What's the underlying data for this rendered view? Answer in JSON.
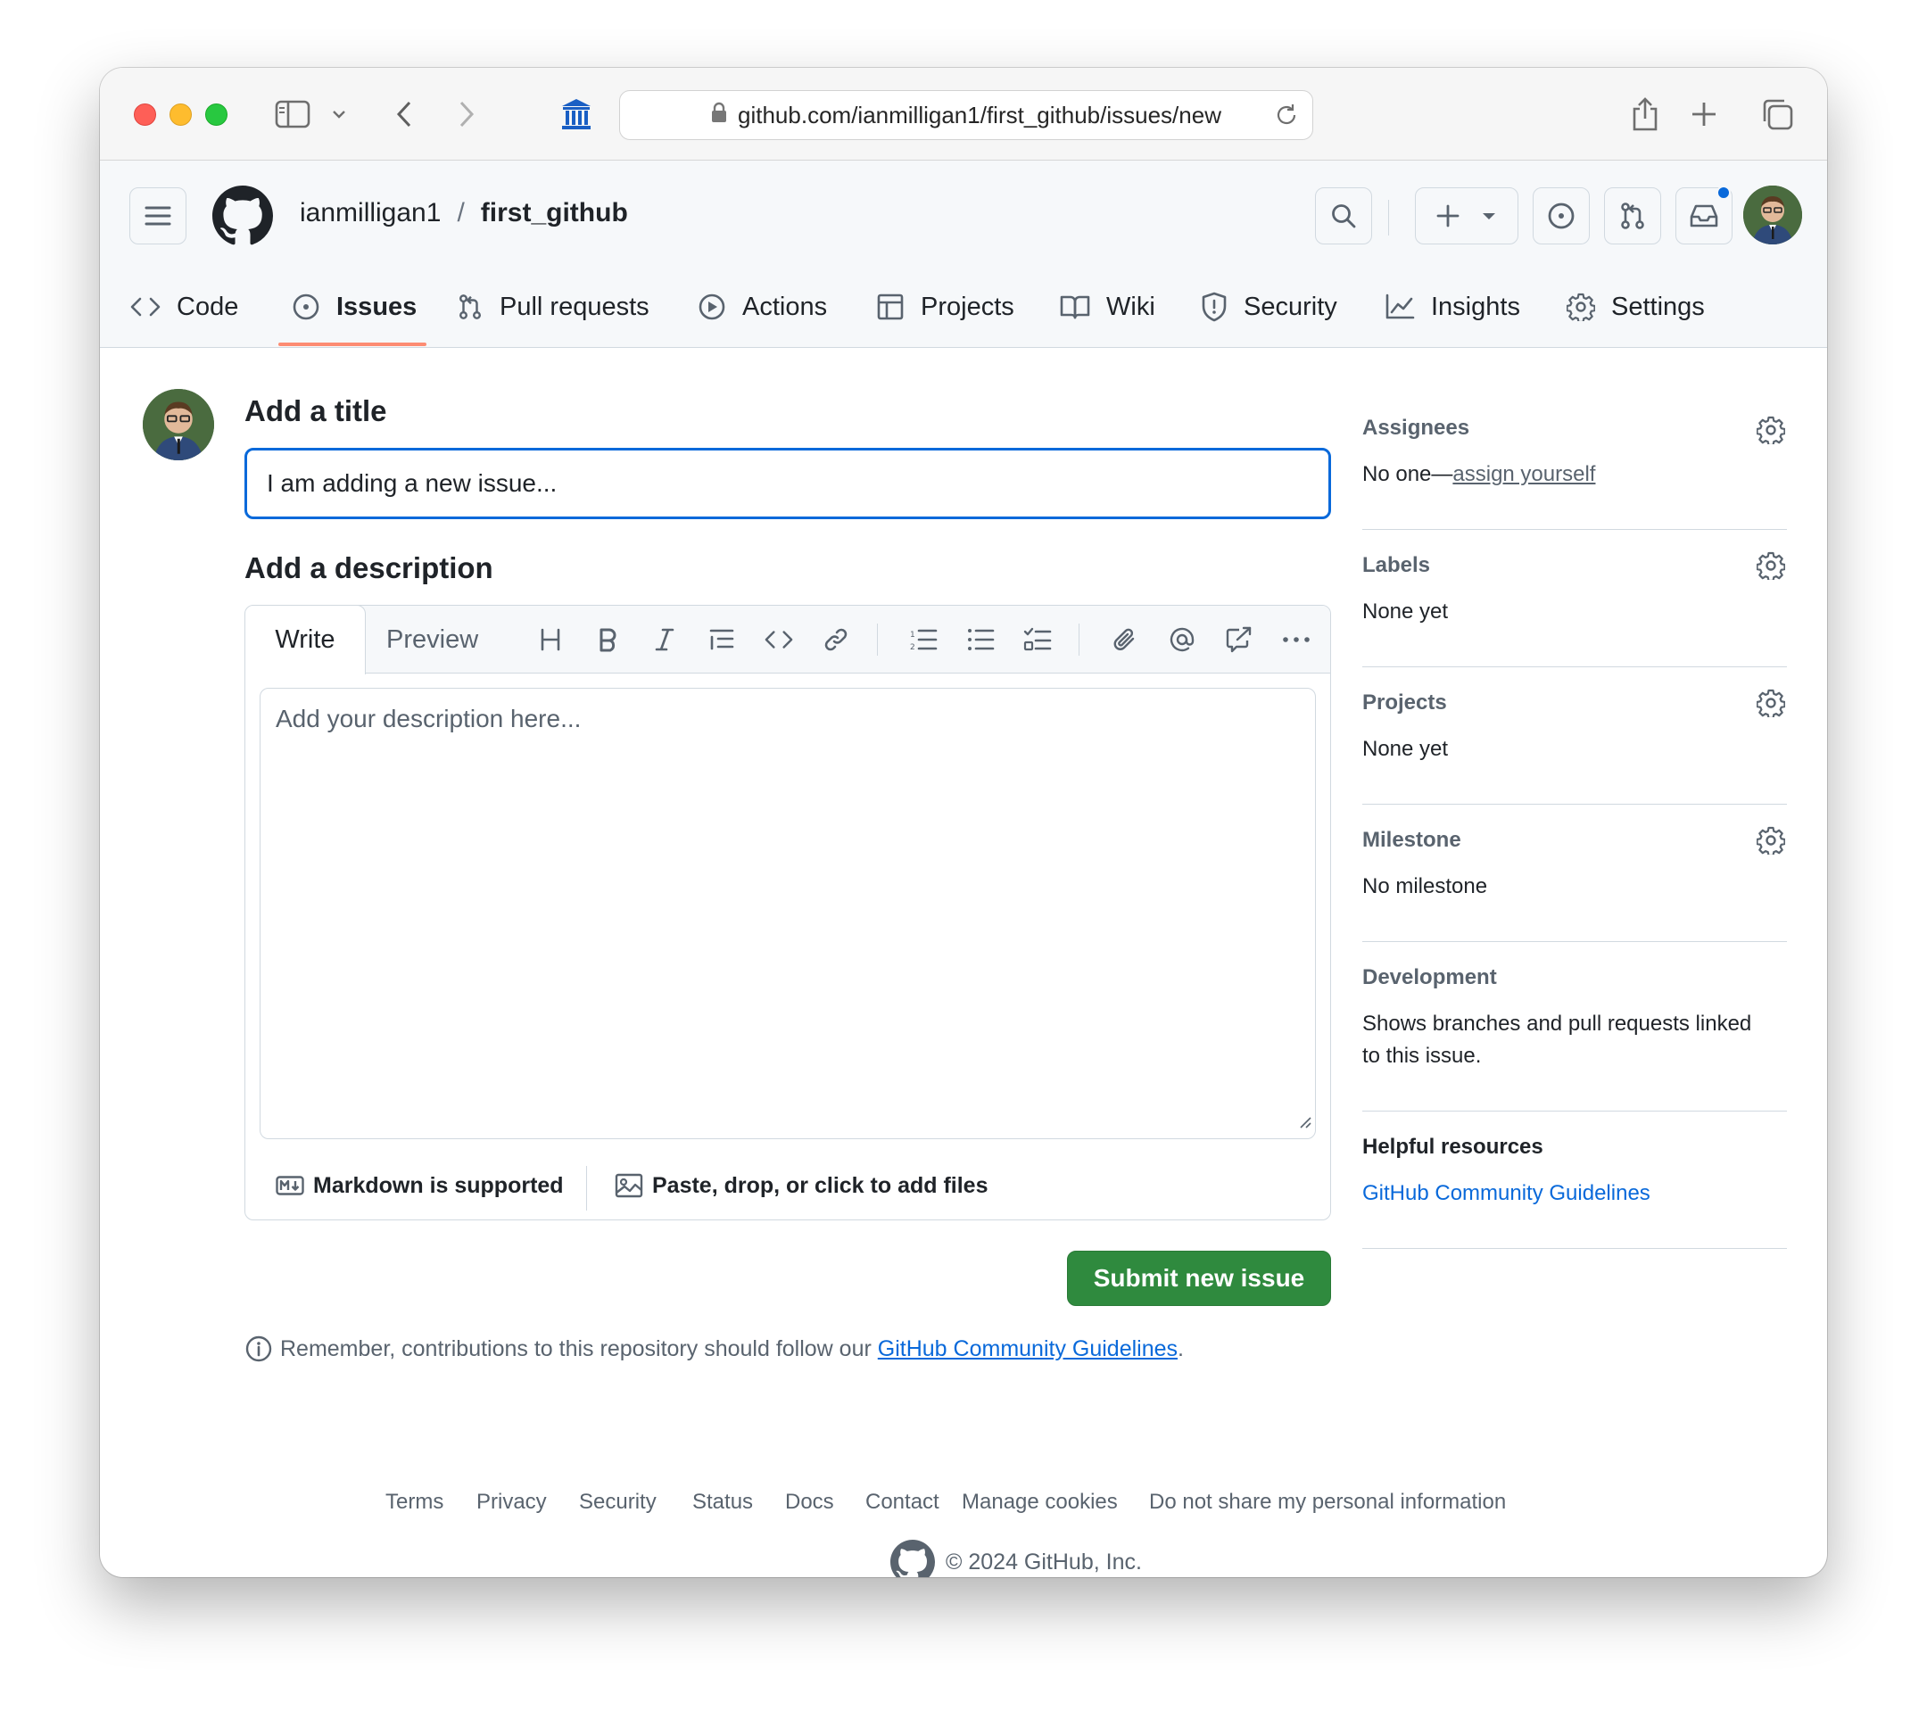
{
  "browser": {
    "url": "github.com/ianmilligan1/first_github/issues/new"
  },
  "repo": {
    "owner": "ianmilligan1",
    "separator": "/",
    "name": "first_github"
  },
  "nav_tabs": [
    {
      "label": "Code",
      "icon": "code-icon"
    },
    {
      "label": "Issues",
      "icon": "issue-opened-icon",
      "active": true
    },
    {
      "label": "Pull requests",
      "icon": "git-pull-request-icon"
    },
    {
      "label": "Actions",
      "icon": "play-icon"
    },
    {
      "label": "Projects",
      "icon": "table-icon"
    },
    {
      "label": "Wiki",
      "icon": "book-icon"
    },
    {
      "label": "Security",
      "icon": "shield-icon"
    },
    {
      "label": "Insights",
      "icon": "graph-icon"
    },
    {
      "label": "Settings",
      "icon": "gear-icon"
    }
  ],
  "form": {
    "title_heading": "Add a title",
    "title_value": "I am adding a new issue...",
    "description_heading": "Add a description",
    "write_tab": "Write",
    "preview_tab": "Preview",
    "description_placeholder": "Add your description here...",
    "markdown_note": "Markdown is supported",
    "attach_note": "Paste, drop, or click to add files",
    "submit_label": "Submit new issue",
    "remember_text": "Remember, contributions to this repository should follow our",
    "remember_link": "GitHub Community Guidelines",
    "remember_end": "."
  },
  "sidebar": {
    "assignees": {
      "label": "Assignees",
      "value_prefix": "No one—",
      "value_link": "assign yourself"
    },
    "labels": {
      "label": "Labels",
      "value": "None yet"
    },
    "projects": {
      "label": "Projects",
      "value": "None yet"
    },
    "milestone": {
      "label": "Milestone",
      "value": "No milestone"
    },
    "development": {
      "label": "Development",
      "value_line1": "Shows branches and pull requests linked",
      "value_line2": "to this issue."
    },
    "resources": {
      "label": "Helpful resources",
      "link": "GitHub Community Guidelines"
    }
  },
  "footer": {
    "links": [
      "Terms",
      "Privacy",
      "Security",
      "Status",
      "Docs",
      "Contact",
      "Manage cookies",
      "Do not share my personal information"
    ],
    "copyright": "© 2024 GitHub, Inc."
  },
  "colors": {
    "accent": "#0969da",
    "submit_green": "#2f8a3e",
    "active_tab_underline": "#fd8c73"
  }
}
